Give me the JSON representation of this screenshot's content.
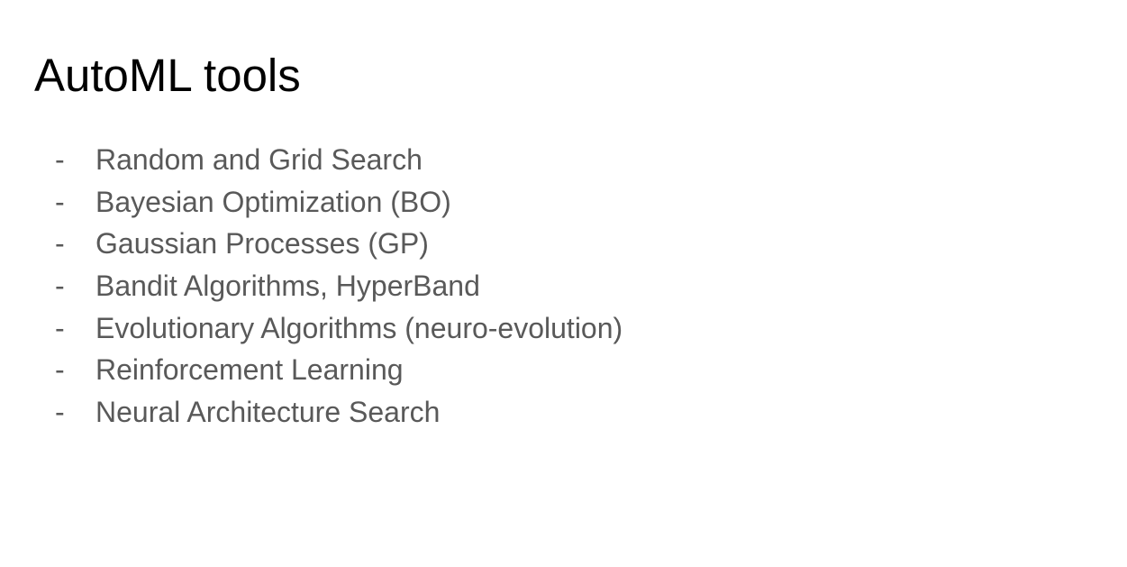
{
  "slide": {
    "title": "AutoML tools",
    "bullet_marker": "-",
    "items": [
      "Random and Grid Search",
      "Bayesian Optimization (BO)",
      "Gaussian Processes (GP)",
      "Bandit Algorithms, HyperBand",
      "Evolutionary Algorithms (neuro-evolution)",
      "Reinforcement Learning",
      "Neural Architecture Search"
    ]
  },
  "colors": {
    "background": "#ffffff",
    "title": "#000000",
    "body_text": "#595959"
  }
}
